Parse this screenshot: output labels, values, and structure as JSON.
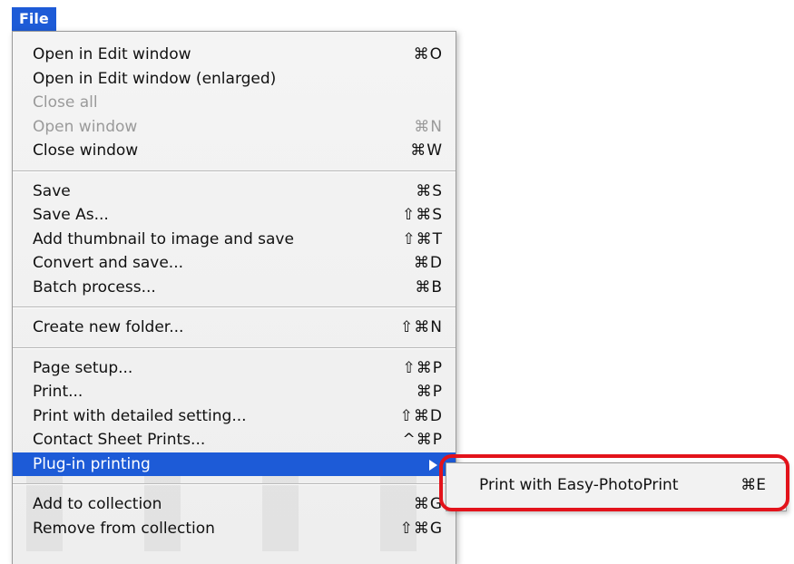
{
  "menu_title": "File",
  "items": [
    {
      "label": "Open in Edit window",
      "shortcut": "⌘O",
      "disabled": false
    },
    {
      "label": "Open in Edit window (enlarged)",
      "shortcut": "",
      "disabled": false
    },
    {
      "label": "Close all",
      "shortcut": "",
      "disabled": true
    },
    {
      "label": "Open window",
      "shortcut": "⌘N",
      "disabled": true
    },
    {
      "label": "Close window",
      "shortcut": "⌘W",
      "disabled": false
    },
    {
      "label": "Save",
      "shortcut": "⌘S",
      "disabled": false
    },
    {
      "label": "Save As...",
      "shortcut": "⇧⌘S",
      "disabled": false
    },
    {
      "label": "Add thumbnail to image and save",
      "shortcut": "⇧⌘T",
      "disabled": false
    },
    {
      "label": "Convert and save...",
      "shortcut": "⌘D",
      "disabled": false
    },
    {
      "label": "Batch process...",
      "shortcut": "⌘B",
      "disabled": false
    },
    {
      "label": "Create new folder...",
      "shortcut": "⇧⌘N",
      "disabled": false
    },
    {
      "label": "Page setup...",
      "shortcut": "⇧⌘P",
      "disabled": false
    },
    {
      "label": "Print...",
      "shortcut": "⌘P",
      "disabled": false
    },
    {
      "label": "Print with detailed setting...",
      "shortcut": "⇧⌘D",
      "disabled": false
    },
    {
      "label": "Contact Sheet Prints...",
      "shortcut": "^⌘P",
      "disabled": false
    },
    {
      "label": "Plug-in printing",
      "shortcut": "",
      "disabled": false,
      "highlighted": true,
      "has_submenu": true
    },
    {
      "label": "Add to collection",
      "shortcut": "⌘G",
      "disabled": false
    },
    {
      "label": "Remove from collection",
      "shortcut": "⇧⌘G",
      "disabled": false
    }
  ],
  "submenu": {
    "label": "Print with Easy-PhotoPrint",
    "shortcut": "⌘E"
  },
  "colors": {
    "highlight": "#1d5bd7",
    "callout": "#e3131b"
  }
}
